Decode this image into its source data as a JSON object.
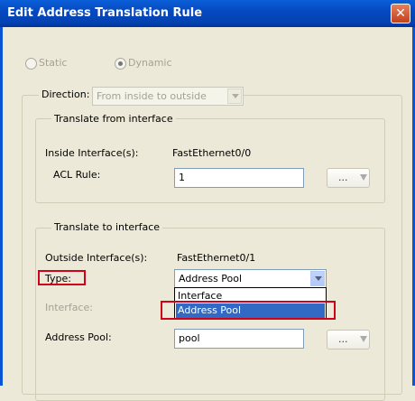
{
  "window": {
    "title": "Edit Address Translation Rule",
    "close_label": "✕"
  },
  "mode": {
    "static_label": "Static",
    "dynamic_label": "Dynamic",
    "selected": "Dynamic"
  },
  "direction": {
    "label": "Direction:",
    "value": "From inside to outside"
  },
  "from_group": {
    "legend": "Translate from interface",
    "inside_label": "Inside Interface(s):",
    "inside_value": "FastEthernet0/0",
    "acl_label": "ACL Rule:",
    "acl_value": "1",
    "browse_label": "..."
  },
  "to_group": {
    "legend": "Translate to interface",
    "outside_label": "Outside Interface(s):",
    "outside_value": "FastEthernet0/1",
    "type_label": "Type:",
    "type_value": "Address Pool",
    "type_options": [
      "Interface",
      "Address Pool"
    ],
    "interface_label": "Interface:",
    "pool_label": "Address Pool:",
    "pool_value": "pool",
    "browse_label": "..."
  },
  "colors": {
    "titlebar": "#0A5FD8",
    "highlight": "#316AC5",
    "annotation": "#D0021B"
  }
}
